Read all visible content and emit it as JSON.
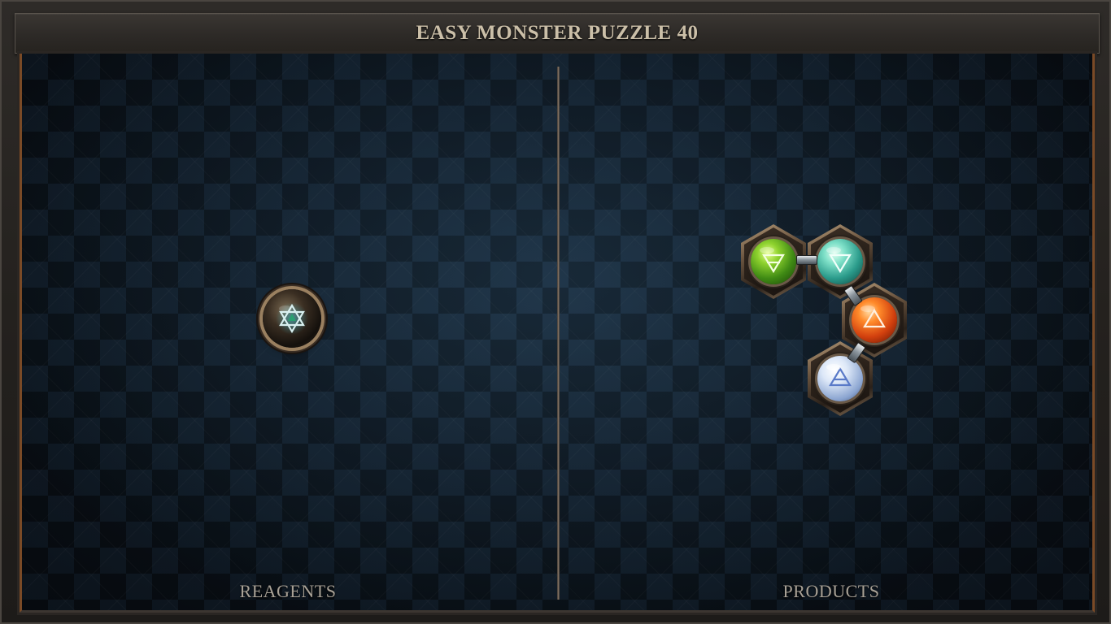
{
  "header": {
    "title": "EASY MONSTER PUZZLE 40"
  },
  "panels": {
    "reagents_label": "REAGENTS",
    "products_label": "PRODUCTS"
  },
  "reagents": [
    {
      "element": "aether",
      "symbol": "star-of-david-icon"
    }
  ],
  "products": [
    {
      "element": "earth",
      "symbol": "earth-triangle-icon",
      "color": "#5aa02a"
    },
    {
      "element": "water",
      "symbol": "water-triangle-icon",
      "color": "#3fb6a8"
    },
    {
      "element": "fire",
      "symbol": "fire-triangle-icon",
      "color": "#e0561a"
    },
    {
      "element": "air",
      "symbol": "air-triangle-icon",
      "color": "#c8d8f0"
    }
  ],
  "colors": {
    "frame": "#2e2b28",
    "board": "#15212d",
    "accent_copper": "#7a4a26",
    "label": "#a8a196",
    "title": "#cbbfa8"
  }
}
